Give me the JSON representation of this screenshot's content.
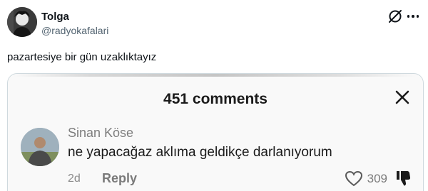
{
  "tweet": {
    "author": {
      "display_name": "Tolga",
      "handle": "@radyokafalari"
    },
    "text": "pazartesiye bir gün uzaklıktayız",
    "icons": {
      "grok": "grok-icon",
      "more": "more-options-icon"
    }
  },
  "embedded_screenshot": {
    "title": "451 comments",
    "close_icon": "close-icon",
    "comment": {
      "author": "Sinan Köse",
      "text": "ne yapacağaz aklıma geldikçe darlanıyorum",
      "time": "2d",
      "reply_label": "Reply",
      "like_count": "309",
      "like_icon": "heart-icon",
      "dislike_icon": "thumbs-down-icon"
    }
  }
}
